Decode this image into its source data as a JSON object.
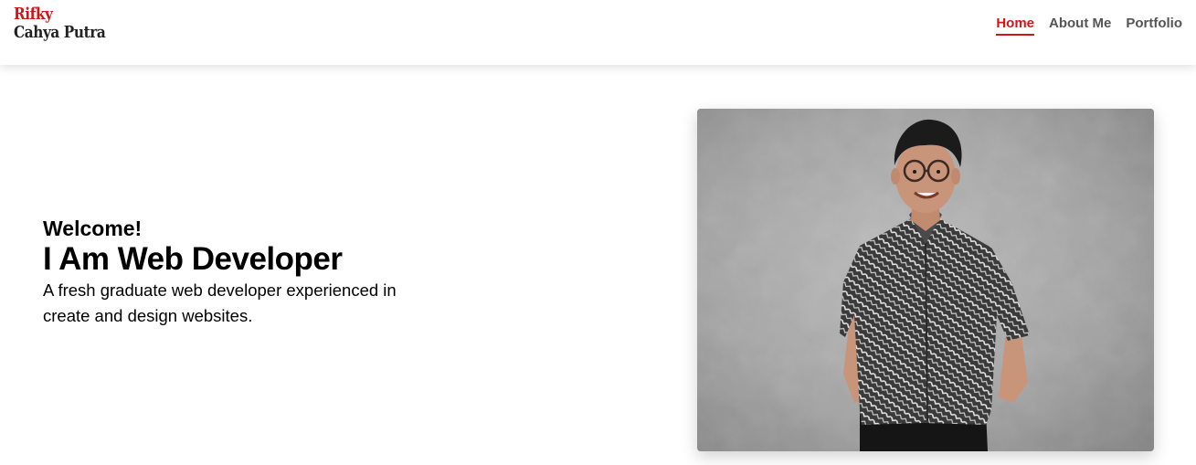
{
  "header": {
    "logo": {
      "line1": "Rifky",
      "line2": "Cahya Putra"
    },
    "nav": [
      {
        "label": "Home",
        "active": true
      },
      {
        "label": "About Me",
        "active": false
      },
      {
        "label": "Portfolio",
        "active": false
      }
    ]
  },
  "hero": {
    "greeting": "Welcome!",
    "headline": "I Am Web Developer",
    "tagline": "A fresh graduate web developer experienced in create and design websites."
  },
  "colors": {
    "accent": "#d0161b",
    "nav_text": "#555555"
  }
}
